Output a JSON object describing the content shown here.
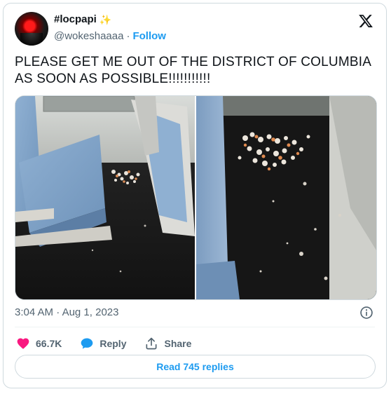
{
  "author": {
    "display_name": "#locpapi",
    "handle": "@wokeshaaaa",
    "separator": "·",
    "follow_label": "Follow"
  },
  "tweet": {
    "text": "PLEASE GET ME OUT OF THE DISTRICT OF COLUMBIA AS SOON AS POSSIBLE!!!!!!!!!!!",
    "time": "3:04 AM",
    "date_separator": "·",
    "date": "Aug 1, 2023"
  },
  "stats": {
    "likes": "66.7K",
    "reply_label": "Reply",
    "share_label": "Share",
    "read_replies_label": "Read 745 replies"
  },
  "colors": {
    "accent": "#1d9bf0",
    "like": "#f91880",
    "muted": "#536471",
    "border": "#cfd9de"
  },
  "icons": {
    "brand": "x-logo-icon",
    "like": "heart-icon",
    "reply": "speech-bubble-icon",
    "share": "share-upload-icon",
    "info": "info-icon",
    "badge": "star-icon"
  }
}
